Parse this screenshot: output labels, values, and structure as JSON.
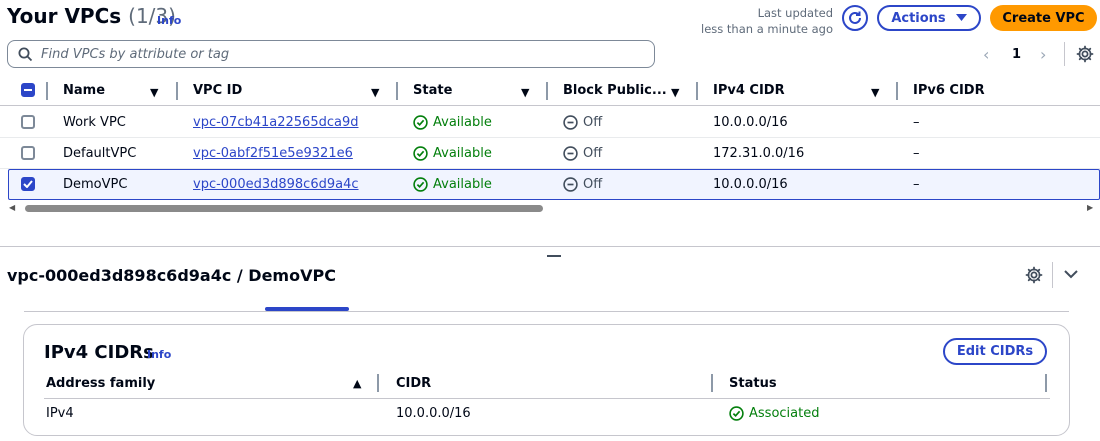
{
  "header": {
    "title": "Your VPCs",
    "count": "(1/3)",
    "info": "Info",
    "last_updated_line1": "Last updated",
    "last_updated_line2": "less than a minute ago",
    "actions_label": "Actions",
    "create_label": "Create VPC"
  },
  "search": {
    "placeholder": "Find VPCs by attribute or tag"
  },
  "pagination": {
    "current_page": "1",
    "prev": "‹",
    "next": "›"
  },
  "table": {
    "columns": [
      "Name",
      "VPC ID",
      "State",
      "Block Public...",
      "IPv4 CIDR",
      "IPv6 CIDR"
    ],
    "rows": [
      {
        "name": "Work VPC",
        "vpc_id": "vpc-07cb41a22565dca9d",
        "state": "Available",
        "block_public": "Off",
        "ipv4": "10.0.0.0/16",
        "ipv6": "–",
        "selected": false
      },
      {
        "name": "DefaultVPC",
        "vpc_id": "vpc-0abf2f51e5e9321e6",
        "state": "Available",
        "block_public": "Off",
        "ipv4": "172.31.0.0/16",
        "ipv6": "–",
        "selected": false
      },
      {
        "name": "DemoVPC",
        "vpc_id": "vpc-000ed3d898c6d9a4c",
        "state": "Available",
        "block_public": "Off",
        "ipv4": "10.0.0.0/16",
        "ipv6": "–",
        "selected": true
      }
    ]
  },
  "details": {
    "title": "vpc-000ed3d898c6d9a4c / DemoVPC",
    "panel_title": "IPv4 CIDRs",
    "panel_info": "Info",
    "edit_label": "Edit CIDRs",
    "columns": [
      "Address family",
      "CIDR",
      "Status"
    ],
    "rows": [
      {
        "family": "IPv4",
        "cidr": "10.0.0.0/16",
        "status": "Associated"
      }
    ]
  },
  "colors": {
    "accent": "#2c46c8",
    "primary_button": "#ff9900",
    "success": "#037f0c"
  }
}
